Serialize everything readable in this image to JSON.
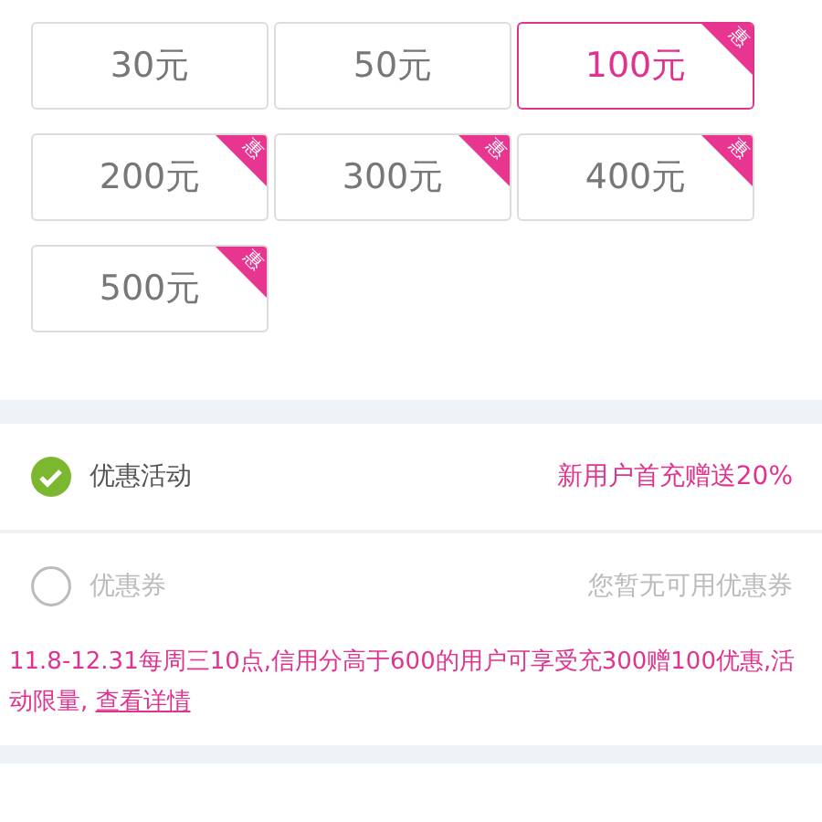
{
  "amounts": [
    {
      "label": "30元",
      "selected": false
    },
    {
      "label": "50元",
      "selected": false
    },
    {
      "label": "100元",
      "selected": true,
      "badge": "惠"
    },
    {
      "label": "200元",
      "selected": false,
      "badge": "惠"
    },
    {
      "label": "300元",
      "selected": false,
      "badge": "惠"
    },
    {
      "label": "400元",
      "selected": false,
      "badge": "惠"
    },
    {
      "label": "500元",
      "selected": false,
      "badge": "惠"
    }
  ],
  "discounts": [
    {
      "label": "优惠活动",
      "value": "新用户首充赠送20%",
      "checked": true,
      "disabled": false
    },
    {
      "label": "优惠券",
      "value": "您暂无可用优惠券",
      "checked": false,
      "disabled": true
    }
  ],
  "note": {
    "text": "11.8-12.31每周三10点,信用分高于600的用户可享受充300赠100优惠,活动限量, ",
    "link": "查看详情"
  }
}
